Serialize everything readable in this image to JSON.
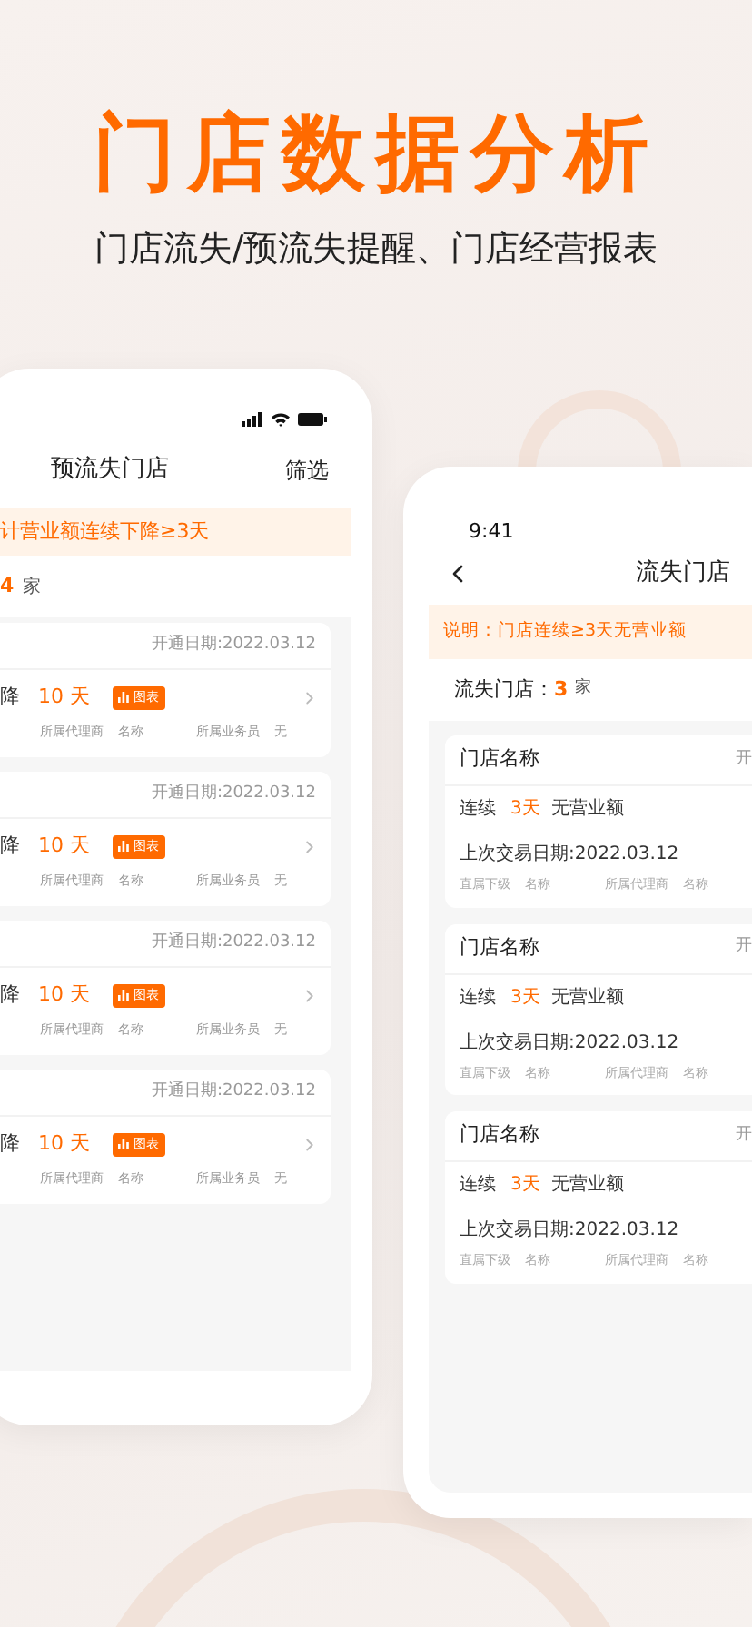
{
  "header": {
    "title": "门店数据分析",
    "subtitle": "门店流失/预流失提醒、门店经营报表"
  },
  "left_phone": {
    "title": "预流失门店",
    "filter": "筛选",
    "notice": "计营业额连续下降≥3天",
    "count": "4",
    "count_unit": "家",
    "stores": [
      {
        "open_date": "开通日期:2022.03.12",
        "trend": "降",
        "days": "10 天",
        "chart_button": "图表",
        "agent_label": "所属代理商",
        "agent": "名称",
        "staff_label": "所属业务员",
        "staff": "无"
      },
      {
        "open_date": "开通日期:2022.03.12",
        "trend": "降",
        "days": "10 天",
        "chart_button": "图表",
        "agent_label": "所属代理商",
        "agent": "名称",
        "staff_label": "所属业务员",
        "staff": "无"
      },
      {
        "open_date": "开通日期:2022.03.12",
        "trend": "降",
        "days": "10 天",
        "chart_button": "图表",
        "agent_label": "所属代理商",
        "agent": "名称",
        "staff_label": "所属业务员",
        "staff": "无"
      },
      {
        "open_date": "开通日期:2022.03.12",
        "trend": "降",
        "days": "10 天",
        "chart_button": "图表",
        "agent_label": "所属代理商",
        "agent": "名称",
        "staff_label": "所属业务员",
        "staff": "无"
      }
    ]
  },
  "right_phone": {
    "time": "9:41",
    "title": "流失门店",
    "notice": "说明：门店连续≥3天无营业额",
    "count_label": "流失门店：",
    "count": "3",
    "count_unit": "家",
    "stores": [
      {
        "name": "门店名称",
        "open_date": "开",
        "prefix": "连续",
        "days": "3天",
        "suffix": "无营业额",
        "last_trade": "上次交易日期:2022.03.12",
        "sub_label": "直属下级",
        "sub": "名称",
        "agent_label": "所属代理商",
        "agent": "名称"
      },
      {
        "name": "门店名称",
        "open_date": "开",
        "prefix": "连续",
        "days": "3天",
        "suffix": "无营业额",
        "last_trade": "上次交易日期:2022.03.12",
        "sub_label": "直属下级",
        "sub": "名称",
        "agent_label": "所属代理商",
        "agent": "名称"
      },
      {
        "name": "门店名称",
        "open_date": "开",
        "prefix": "连续",
        "days": "3天",
        "suffix": "无营业额",
        "last_trade": "上次交易日期:2022.03.12",
        "sub_label": "直属下级",
        "sub": "名称",
        "agent_label": "所属代理商",
        "agent": "名称"
      }
    ]
  }
}
